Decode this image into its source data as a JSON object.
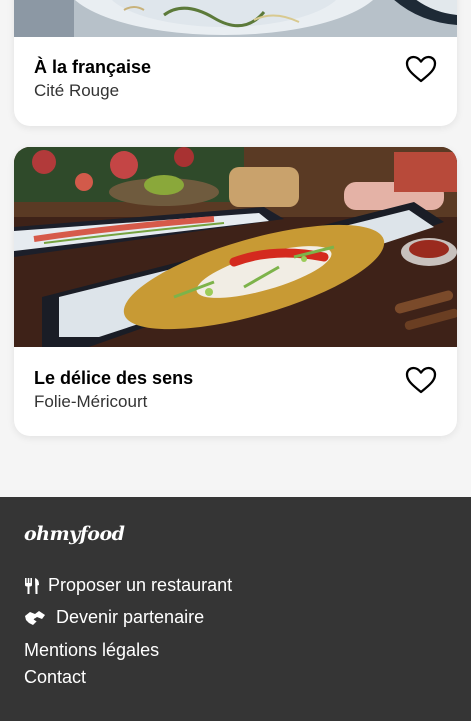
{
  "restaurants": [
    {
      "name": "À la française",
      "location": "Cité Rouge",
      "favorite_icon": "heart-outline-icon"
    },
    {
      "name": "Le délice des sens",
      "location": "Folie-Méricourt",
      "favorite_icon": "heart-outline-icon"
    }
  ],
  "footer": {
    "logo": "ohmyfood",
    "links": [
      {
        "label": "Proposer un restaurant",
        "icon": "utensils-icon"
      },
      {
        "label": "Devenir partenaire",
        "icon": "handshake-icon"
      },
      {
        "label": "Mentions légales"
      },
      {
        "label": "Contact"
      }
    ]
  },
  "colors": {
    "background": "#f5f5f5",
    "card": "#ffffff",
    "footer": "#353535"
  }
}
